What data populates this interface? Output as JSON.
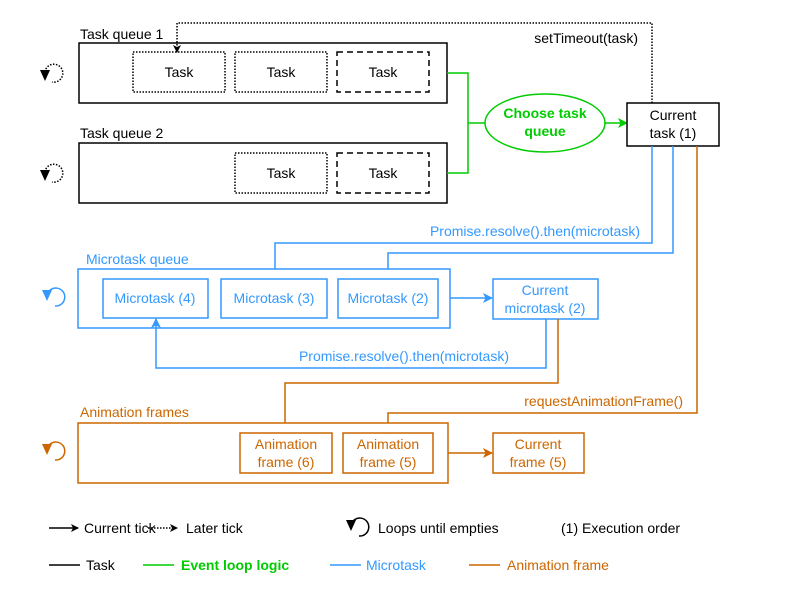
{
  "colors": {
    "task": "#000000",
    "event_loop": "#00CC00",
    "microtask": "#3399FF",
    "animation_frame": "#CC6600"
  },
  "task_queue_1": {
    "label": "Task queue 1",
    "tasks": [
      "Task",
      "Task",
      "Task"
    ]
  },
  "task_queue_2": {
    "label": "Task queue 2",
    "tasks": [
      "Task",
      "Task"
    ]
  },
  "choose_queue": {
    "line1": "Choose task",
    "line2": "queue"
  },
  "current_task": {
    "line1": "Current",
    "line2": "task (1)"
  },
  "set_timeout_label": "setTimeout(task)",
  "microtask_queue": {
    "label": "Microtask queue",
    "items": [
      "Microtask (4)",
      "Microtask (3)",
      "Microtask (2)"
    ]
  },
  "promise_label_top": "Promise.resolve().then(microtask)",
  "promise_label_bottom": "Promise.resolve().then(microtask)",
  "current_microtask": {
    "line1": "Current",
    "line2": "microtask (2)"
  },
  "raf_label": "requestAnimationFrame()",
  "animation_frames": {
    "label": "Animation frames",
    "items": [
      {
        "line1": "Animation",
        "line2": "frame (6)"
      },
      {
        "line1": "Animation",
        "line2": "frame (5)"
      }
    ]
  },
  "current_frame": {
    "line1": "Current",
    "line2": "frame (5)"
  },
  "legend": {
    "row1": [
      "Current tick",
      "Later tick",
      "Loops until empties",
      "(1) Execution order"
    ],
    "row2": [
      "Task",
      "Event loop logic",
      "Microtask",
      "Animation frame"
    ]
  }
}
